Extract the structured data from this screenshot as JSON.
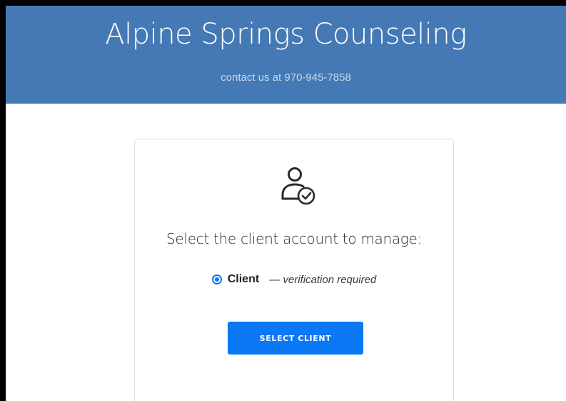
{
  "header": {
    "title": "Alpine Springs Counseling",
    "contact": "contact us at 970-945-7858"
  },
  "card": {
    "icon": "user-check-icon",
    "prompt": "Select the client account to manage:",
    "option": {
      "label": "Client",
      "note": "— verification required",
      "selected": true
    },
    "button_label": "SELECT CLIENT"
  },
  "colors": {
    "header_bg": "#4479b5",
    "accent": "#0b79f5",
    "radio": "#1a73e8"
  }
}
